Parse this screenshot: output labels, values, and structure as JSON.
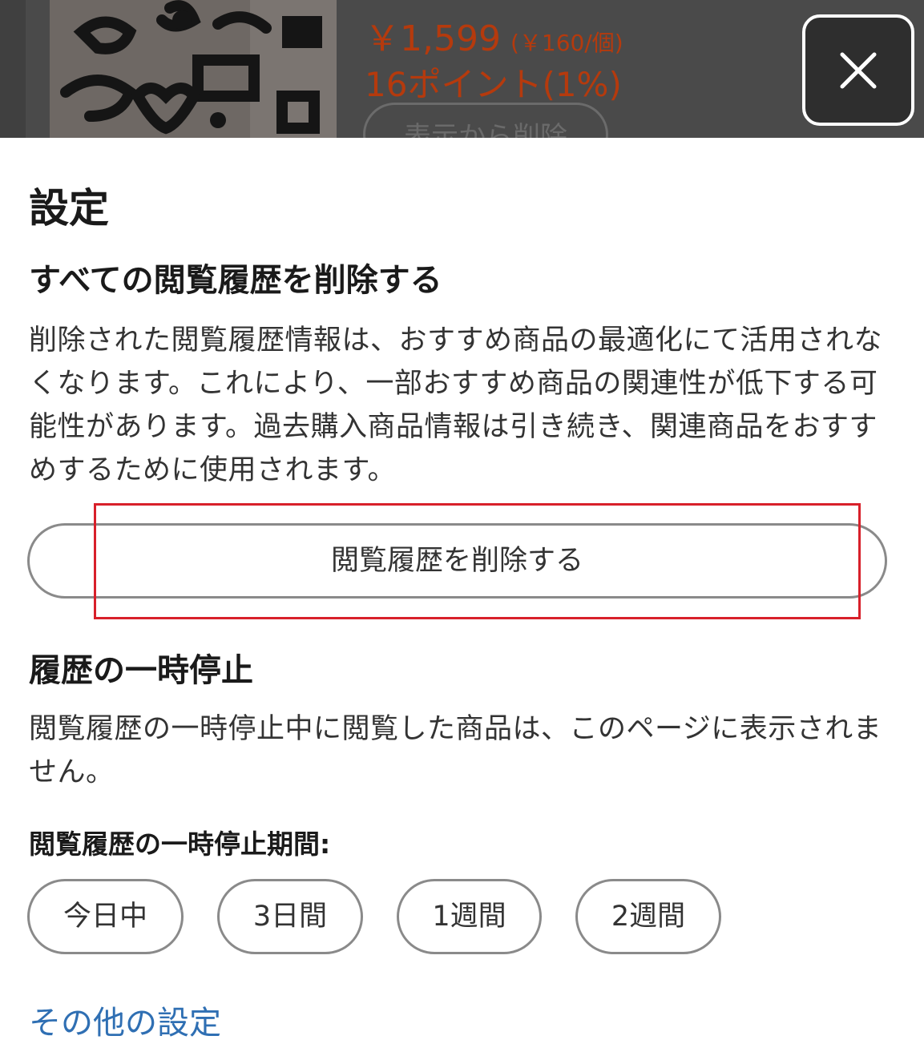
{
  "background_item": {
    "price": "￥1,599",
    "unit_price": "(￥160/個)",
    "points": "16ポイント(1%)",
    "remove_label": "表示から削除",
    "price_color": "#b53a0d"
  },
  "close_icon": "close-icon",
  "settings": {
    "title": "設定",
    "delete_all": {
      "heading": "すべての閲覧履歴を削除する",
      "description": "削除された閲覧履歴情報は、おすすめ商品の最適化にて活用されなくなります。これにより、一部おすすめ商品の関連性が低下する可能性があります。過去購入商品情報は引き続き、関連商品をおすすめするために使用されます。",
      "button_label": "閲覧履歴を削除する"
    },
    "pause": {
      "heading": "履歴の一時停止",
      "description": "閲覧履歴の一時停止中に閲覧した商品は、このページに表示されません。",
      "period_label": "閲覧履歴の一時停止期間:",
      "options": [
        "今日中",
        "3日間",
        "1週間",
        "2週間"
      ]
    },
    "more_link": "その他の設定",
    "link_color": "#2f6fb3",
    "highlight_color": "#d8202a"
  }
}
